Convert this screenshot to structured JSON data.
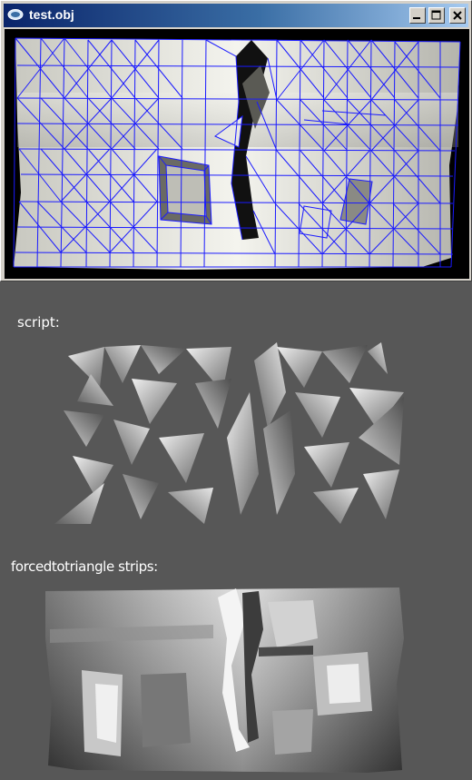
{
  "window": {
    "title": "test.obj",
    "controls": [
      "minimize",
      "maximize",
      "close"
    ]
  },
  "captions": {
    "script": "script:",
    "strips": "forcedtotriangle strips:"
  },
  "colors": {
    "desktop": "#575757",
    "wireframe": "#1a1aff",
    "viewport_bg": "#000000"
  }
}
